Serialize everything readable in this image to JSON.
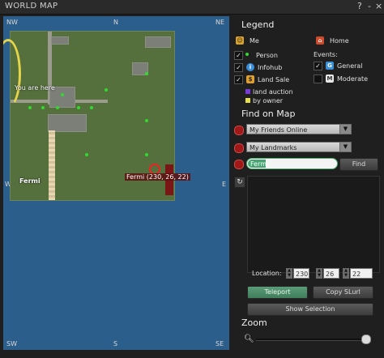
{
  "window": {
    "title": "WORLD MAP",
    "help": "?",
    "minimize": "-",
    "close": "×"
  },
  "map": {
    "compass": {
      "nw": "NW",
      "n": "N",
      "ne": "NE",
      "w": "W",
      "e": "E",
      "sw": "SW",
      "s": "S",
      "se": "SE"
    },
    "you_are_here": "You are here",
    "region_name": "Fermi",
    "pin_label": "Fermi (230, 26, 22)"
  },
  "legend": {
    "title": "Legend",
    "me": "Me",
    "home": "Home",
    "person": "Person",
    "infohub": "Infohub",
    "land_sale": "Land Sale",
    "land_auction": "land auction",
    "by_owner": "by owner",
    "events": "Events:",
    "general": "General",
    "moderate": "Moderate",
    "checks": {
      "person": true,
      "infohub": true,
      "land_sale": true,
      "general": true,
      "moderate": false
    }
  },
  "find": {
    "title": "Find on Map",
    "friends_online": "My Friends Online",
    "landmarks": "My Landmarks",
    "search_value": "Fermi",
    "find_button": "Find"
  },
  "location": {
    "label": "Location:",
    "x": "230",
    "y": "26",
    "z": "22"
  },
  "buttons": {
    "teleport": "Teleport",
    "copy_slurl": "Copy SLurl",
    "show_selection": "Show Selection"
  },
  "zoom": {
    "label": "Zoom",
    "level": 0.96
  },
  "colors": {
    "accent": "#46a572",
    "auction": "#7a3ad8",
    "owner": "#e5e04a"
  }
}
